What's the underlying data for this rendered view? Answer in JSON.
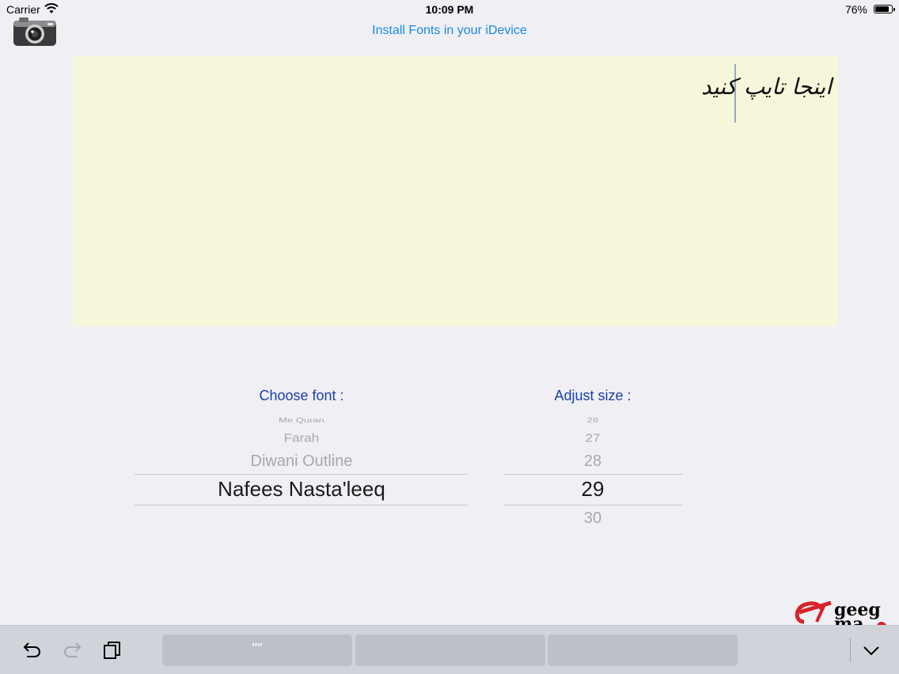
{
  "status_bar": {
    "carrier": "Carrier",
    "time": "10:09 PM",
    "battery": "76%",
    "battery_level": 0.76
  },
  "header": {
    "camera_icon": "camera-icon",
    "install_link": "Install Fonts in your iDevice"
  },
  "editor": {
    "text": "اینجا تایپ کنید",
    "background": "#f5f6da"
  },
  "font_picker": {
    "label": "Choose font :",
    "items": [
      "Me Quran",
      "Farah",
      "Diwani Outline",
      "Nafees Nasta'leeq"
    ],
    "selected": "Nafees Nasta'leeq"
  },
  "size_picker": {
    "label": "Adjust size :",
    "items": [
      "26",
      "27",
      "28",
      "29",
      "30"
    ],
    "selected": "29"
  },
  "watermark": "geeg",
  "toolbar": {
    "undo_icon": "undo-icon",
    "redo_icon": "redo-icon",
    "paste_icon": "paste-icon",
    "quote_key": "\"\"",
    "dismiss_icon": "chevron-down-icon"
  },
  "colors": {
    "accent": "#1a8ae6",
    "label": "#1c3fa8"
  }
}
